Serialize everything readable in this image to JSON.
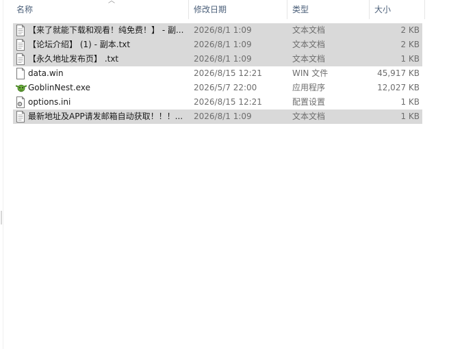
{
  "columns": {
    "name": "名称",
    "date": "修改日期",
    "type": "类型",
    "size": "大小"
  },
  "files": [
    {
      "name": "【来了就能下载和观看！纯免费！】 - 副...",
      "date": "2026/8/1 1:09",
      "type": "文本文档",
      "size": "2 KB",
      "icon": "text-file-icon",
      "selected": true
    },
    {
      "name": "【论坛介绍】 (1) - 副本.txt",
      "date": "2026/8/1 1:09",
      "type": "文本文档",
      "size": "2 KB",
      "icon": "text-file-icon",
      "selected": true
    },
    {
      "name": "【永久地址发布页】 .txt",
      "date": "2026/8/1 1:09",
      "type": "文本文档",
      "size": "1 KB",
      "icon": "text-file-icon",
      "selected": true
    },
    {
      "name": "data.win",
      "date": "2026/8/15 12:21",
      "type": "WIN 文件",
      "size": "45,917 KB",
      "icon": "blank-file-icon",
      "selected": false
    },
    {
      "name": "GoblinNest.exe",
      "date": "2026/5/7 22:00",
      "type": "应用程序",
      "size": "12,027 KB",
      "icon": "goblin-app-icon",
      "selected": false
    },
    {
      "name": "options.ini",
      "date": "2026/8/15 12:21",
      "type": "配置设置",
      "size": "1 KB",
      "icon": "settings-file-icon",
      "selected": false
    },
    {
      "name": "最新地址及APP请发邮箱自动获取！！！...",
      "date": "2026/8/1 1:09",
      "type": "文本文档",
      "size": "1 KB",
      "icon": "text-file-icon",
      "selected": true
    }
  ],
  "colors": {
    "selection": "#d9d9d9",
    "header_text": "#4c607a",
    "secondary_text": "#6d6d6d"
  }
}
